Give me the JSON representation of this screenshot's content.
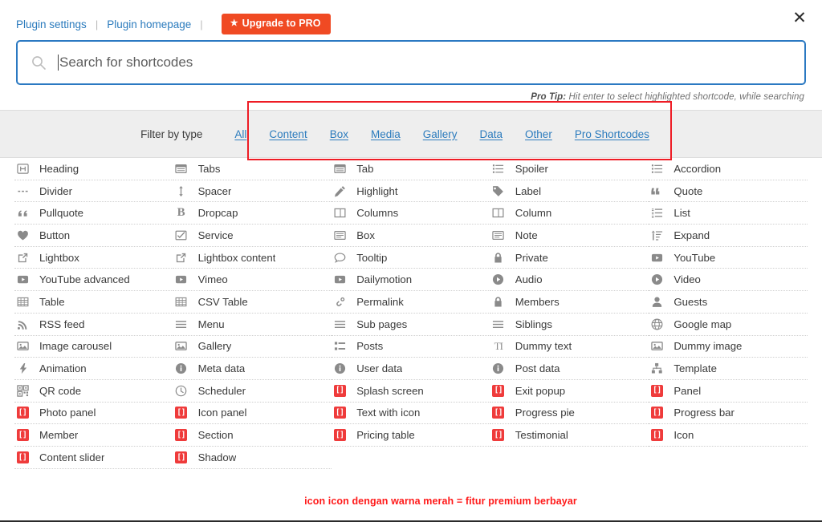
{
  "header": {
    "links": [
      {
        "label": "Plugin settings",
        "name": "plugin-settings-link"
      },
      {
        "label": "Plugin homepage",
        "name": "plugin-homepage-link"
      }
    ],
    "separator": "|",
    "upgrade_button": "Upgrade to PRO",
    "upgrade_star": "★",
    "close_label": "✕"
  },
  "search": {
    "placeholder": "Search for shortcodes",
    "value": "",
    "icon": "search-icon",
    "pro_tip_prefix": "Pro Tip:",
    "pro_tip_text": " Hit enter to select highlighted shortcode, while searching"
  },
  "filter": {
    "label": "Filter by type",
    "options": [
      {
        "label": "All",
        "name": "filter-all"
      },
      {
        "label": "Content",
        "name": "filter-content"
      },
      {
        "label": "Box",
        "name": "filter-box"
      },
      {
        "label": "Media",
        "name": "filter-media"
      },
      {
        "label": "Gallery",
        "name": "filter-gallery"
      },
      {
        "label": "Data",
        "name": "filter-data"
      },
      {
        "label": "Other",
        "name": "filter-other"
      },
      {
        "label": "Pro Shortcodes",
        "name": "filter-pro-shortcodes"
      }
    ]
  },
  "annotation": {
    "text": "icon icon dengan warna merah = fitur premium berbayar",
    "color": "#ff1a1a"
  },
  "colors": {
    "accent_blue": "#2b7bbd",
    "pro_orange": "#f04a23",
    "pro_red": "#ef3b3b",
    "highlight_red": "#ee1c25",
    "filter_bar_bg": "#eeeeee"
  },
  "shortcodes": {
    "columns": [
      [
        {
          "label": "Heading",
          "icon": "heading-icon",
          "pro": false
        },
        {
          "label": "Divider",
          "icon": "divider-icon",
          "pro": false
        },
        {
          "label": "Pullquote",
          "icon": "pullquote-icon",
          "pro": false
        },
        {
          "label": "Button",
          "icon": "heart-icon",
          "pro": false
        },
        {
          "label": "Lightbox",
          "icon": "external-link-icon",
          "pro": false
        },
        {
          "label": "YouTube advanced",
          "icon": "video-play-icon",
          "pro": false
        },
        {
          "label": "Table",
          "icon": "table-icon",
          "pro": false
        },
        {
          "label": "RSS feed",
          "icon": "rss-icon",
          "pro": false
        },
        {
          "label": "Image carousel",
          "icon": "image-icon",
          "pro": false
        },
        {
          "label": "Animation",
          "icon": "bolt-icon",
          "pro": false
        },
        {
          "label": "QR code",
          "icon": "qrcode-icon",
          "pro": false
        },
        {
          "label": "Photo panel",
          "icon": "pro-bracket-icon",
          "pro": true
        },
        {
          "label": "Member",
          "icon": "pro-bracket-icon",
          "pro": true
        },
        {
          "label": "Content slider",
          "icon": "pro-bracket-icon",
          "pro": true
        }
      ],
      [
        {
          "label": "Tabs",
          "icon": "tabs-icon",
          "pro": false
        },
        {
          "label": "Spacer",
          "icon": "spacer-arrows-icon",
          "pro": false
        },
        {
          "label": "Dropcap",
          "icon": "dropcap-b-icon",
          "pro": false
        },
        {
          "label": "Service",
          "icon": "checkbox-icon",
          "pro": false
        },
        {
          "label": "Lightbox content",
          "icon": "external-link-icon",
          "pro": false
        },
        {
          "label": "Vimeo",
          "icon": "video-play-icon",
          "pro": false
        },
        {
          "label": "CSV Table",
          "icon": "table-icon",
          "pro": false
        },
        {
          "label": "Menu",
          "icon": "hamburger-icon",
          "pro": false
        },
        {
          "label": "Gallery",
          "icon": "image-icon",
          "pro": false
        },
        {
          "label": "Meta data",
          "icon": "info-circle-icon",
          "pro": false
        },
        {
          "label": "Scheduler",
          "icon": "clock-icon",
          "pro": false
        },
        {
          "label": "Icon panel",
          "icon": "pro-bracket-icon",
          "pro": true
        },
        {
          "label": "Section",
          "icon": "pro-bracket-icon",
          "pro": true
        },
        {
          "label": "Shadow",
          "icon": "pro-bracket-icon",
          "pro": true
        }
      ],
      [
        {
          "label": "Tab",
          "icon": "tab-icon",
          "pro": false
        },
        {
          "label": "Highlight",
          "icon": "pencil-icon",
          "pro": false
        },
        {
          "label": "Columns",
          "icon": "columns-icon",
          "pro": false
        },
        {
          "label": "Box",
          "icon": "box-lines-icon",
          "pro": false
        },
        {
          "label": "Tooltip",
          "icon": "speech-bubble-icon",
          "pro": false
        },
        {
          "label": "Dailymotion",
          "icon": "video-play-icon",
          "pro": false
        },
        {
          "label": "Permalink",
          "icon": "link-chain-icon",
          "pro": false
        },
        {
          "label": "Sub pages",
          "icon": "hamburger-icon",
          "pro": false
        },
        {
          "label": "Posts",
          "icon": "list-blocks-icon",
          "pro": false
        },
        {
          "label": "User data",
          "icon": "info-circle-icon",
          "pro": false
        },
        {
          "label": "Splash screen",
          "icon": "pro-bracket-icon",
          "pro": true
        },
        {
          "label": "Text with icon",
          "icon": "pro-bracket-icon",
          "pro": true
        },
        {
          "label": "Pricing table",
          "icon": "pro-bracket-icon",
          "pro": true
        }
      ],
      [
        {
          "label": "Spoiler",
          "icon": "list-lines-icon",
          "pro": false
        },
        {
          "label": "Label",
          "icon": "tag-icon",
          "pro": false
        },
        {
          "label": "Column",
          "icon": "columns-icon",
          "pro": false
        },
        {
          "label": "Note",
          "icon": "box-lines-icon",
          "pro": false
        },
        {
          "label": "Private",
          "icon": "lock-icon",
          "pro": false
        },
        {
          "label": "Audio",
          "icon": "audio-play-icon",
          "pro": false
        },
        {
          "label": "Members",
          "icon": "lock-icon",
          "pro": false
        },
        {
          "label": "Siblings",
          "icon": "hamburger-icon",
          "pro": false
        },
        {
          "label": "Dummy text",
          "icon": "text-ti-icon",
          "pro": false
        },
        {
          "label": "Post data",
          "icon": "info-circle-icon",
          "pro": false
        },
        {
          "label": "Exit popup",
          "icon": "pro-bracket-icon",
          "pro": true
        },
        {
          "label": "Progress pie",
          "icon": "pro-bracket-icon",
          "pro": true
        },
        {
          "label": "Testimonial",
          "icon": "pro-bracket-icon",
          "pro": true
        }
      ],
      [
        {
          "label": "Accordion",
          "icon": "list-lines-icon",
          "pro": false
        },
        {
          "label": "Quote",
          "icon": "quote-icon",
          "pro": false
        },
        {
          "label": "List",
          "icon": "ordered-list-icon",
          "pro": false
        },
        {
          "label": "Expand",
          "icon": "sort-expand-icon",
          "pro": false
        },
        {
          "label": "YouTube",
          "icon": "video-play-icon",
          "pro": false
        },
        {
          "label": "Video",
          "icon": "audio-play-icon",
          "pro": false
        },
        {
          "label": "Guests",
          "icon": "user-icon",
          "pro": false
        },
        {
          "label": "Google map",
          "icon": "globe-icon",
          "pro": false
        },
        {
          "label": "Dummy image",
          "icon": "image-icon",
          "pro": false
        },
        {
          "label": "Template",
          "icon": "sitemap-icon",
          "pro": false
        },
        {
          "label": "Panel",
          "icon": "pro-bracket-icon",
          "pro": true
        },
        {
          "label": "Progress bar",
          "icon": "pro-bracket-icon",
          "pro": true
        },
        {
          "label": "Icon",
          "icon": "pro-bracket-icon",
          "pro": true
        }
      ]
    ]
  }
}
